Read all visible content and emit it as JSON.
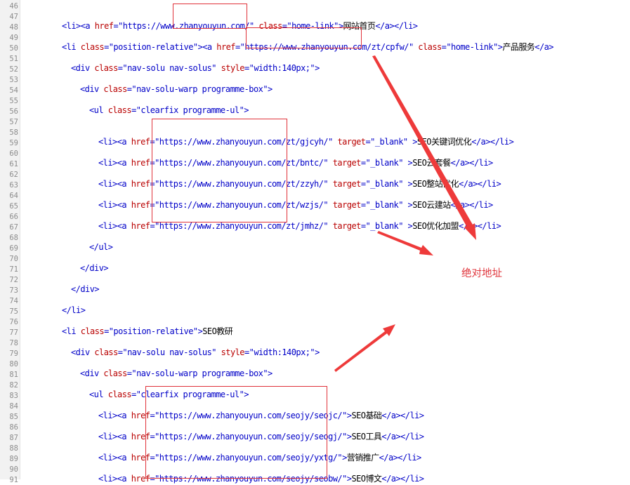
{
  "editor": {
    "line_numbers": [
      "46",
      "47",
      "48",
      "49",
      "50",
      "51",
      "52",
      "53",
      "54",
      "55",
      "56",
      "57",
      "58",
      "59",
      "60",
      "61",
      "62",
      "63",
      "64",
      "65",
      "66",
      "67",
      "68",
      "69",
      "70",
      "71",
      "72",
      "73",
      "74",
      "75",
      "76",
      "77",
      "78",
      "79",
      "80",
      "81",
      "82",
      "83",
      "84",
      "85",
      "86",
      "87",
      "88",
      "89",
      "90",
      "91"
    ],
    "lines": [
      {
        "ln": "47",
        "tokens": [
          [
            "t",
            "<li><a "
          ],
          [
            "a",
            "href"
          ],
          [
            "t",
            "=\"https://www."
          ],
          [
            "t",
            "zhanyouyun.com/"
          ],
          [
            "t",
            "\" "
          ],
          [
            "a",
            "class"
          ],
          [
            "t",
            "=\"home-link\">"
          ],
          [
            "x",
            "网站首页"
          ],
          [
            "t",
            "</a></li>"
          ]
        ]
      },
      {
        "ln": "49",
        "tokens": [
          [
            "t",
            "<li "
          ],
          [
            "a",
            "class"
          ],
          [
            "t",
            "=\"position-relative\"><a "
          ],
          [
            "a",
            "href"
          ],
          [
            "t",
            "=\"https://www.zhanyouyun.com/zt/cpfw/\" "
          ],
          [
            "a",
            "class"
          ],
          [
            "t",
            "=\"home-link\">"
          ],
          [
            "x",
            "产品服务"
          ],
          [
            "t",
            "</a>"
          ]
        ]
      },
      {
        "ln": "51",
        "tokens": [
          [
            "t",
            "<div "
          ],
          [
            "a",
            "class"
          ],
          [
            "t",
            "=\"nav-solu nav-solus\" "
          ],
          [
            "a",
            "style"
          ],
          [
            "t",
            "=\"width:140px;\">"
          ]
        ]
      },
      {
        "ln": "53",
        "tokens": [
          [
            "t",
            "<div "
          ],
          [
            "a",
            "class"
          ],
          [
            "t",
            "=\"nav-solu-warp programme-box\">"
          ]
        ]
      },
      {
        "ln": "55",
        "tokens": [
          [
            "t",
            "<ul "
          ],
          [
            "a",
            "class"
          ],
          [
            "t",
            "=\"clearfix programme-ul\">"
          ]
        ]
      },
      {
        "ln": "58",
        "tokens": [
          [
            "t",
            "<li><a "
          ],
          [
            "a",
            "href"
          ],
          [
            "t",
            "=\"https://www.zhanyouyun.com/zt/gjcyh/\" "
          ],
          [
            "a",
            "target"
          ],
          [
            "t",
            "=\"_blank\" >"
          ],
          [
            "x",
            "SEO关键词优化"
          ],
          [
            "t",
            "</a></li>"
          ]
        ]
      },
      {
        "ln": "60",
        "tokens": [
          [
            "t",
            "<li><a "
          ],
          [
            "a",
            "href"
          ],
          [
            "t",
            "=\"https://www.zhanyouyun.com/zt/bntc/\" "
          ],
          [
            "a",
            "target"
          ],
          [
            "t",
            "=\"_blank\" >"
          ],
          [
            "x",
            "SEO云套餐"
          ],
          [
            "t",
            "</a></li>"
          ]
        ]
      },
      {
        "ln": "62",
        "tokens": [
          [
            "t",
            "<li><a "
          ],
          [
            "a",
            "href"
          ],
          [
            "t",
            "=\"https://www.zhanyouyun.com/zt/zzyh/\" "
          ],
          [
            "a",
            "target"
          ],
          [
            "t",
            "=\"_blank\" >"
          ],
          [
            "x",
            "SEO整站优化"
          ],
          [
            "t",
            "</a></li>"
          ]
        ]
      },
      {
        "ln": "64",
        "tokens": [
          [
            "t",
            "<li><a "
          ],
          [
            "a",
            "href"
          ],
          [
            "t",
            "=\"https://www.zhanyouyun.com/zt/wzjs/\" "
          ],
          [
            "a",
            "target"
          ],
          [
            "t",
            "=\"_blank\" >"
          ],
          [
            "x",
            "SEO云建站"
          ],
          [
            "t",
            "</a></li>"
          ]
        ]
      },
      {
        "ln": "66",
        "tokens": [
          [
            "t",
            "<li><a "
          ],
          [
            "a",
            "href"
          ],
          [
            "t",
            "=\"https://www.zhanyouyun.com/zt/jmhz/\" "
          ],
          [
            "a",
            "target"
          ],
          [
            "t",
            "=\"_blank\" >"
          ],
          [
            "x",
            "SEO优化加盟"
          ],
          [
            "t",
            "</a></li>"
          ]
        ]
      },
      {
        "ln": "68",
        "tokens": [
          [
            "t",
            "</ul>"
          ]
        ]
      },
      {
        "ln": "70",
        "tokens": [
          [
            "t",
            "</div>"
          ]
        ]
      },
      {
        "ln": "72",
        "tokens": [
          [
            "t",
            "</div>"
          ]
        ]
      },
      {
        "ln": "74",
        "tokens": [
          [
            "t",
            "</li>"
          ]
        ]
      },
      {
        "ln": "76",
        "tokens": [
          [
            "t",
            "<li "
          ],
          [
            "a",
            "class"
          ],
          [
            "t",
            "=\"position-relative\">"
          ],
          [
            "x",
            "SEO教研"
          ]
        ]
      },
      {
        "ln": "78",
        "tokens": [
          [
            "t",
            "<div "
          ],
          [
            "a",
            "class"
          ],
          [
            "t",
            "=\"nav-solu nav-solus\" "
          ],
          [
            "a",
            "style"
          ],
          [
            "t",
            "=\"width:140px;\">"
          ]
        ]
      },
      {
        "ln": "80",
        "tokens": [
          [
            "t",
            "<div "
          ],
          [
            "a",
            "class"
          ],
          [
            "t",
            "=\"nav-solu-warp programme-box\">"
          ]
        ]
      },
      {
        "ln": "82",
        "tokens": [
          [
            "t",
            "<ul "
          ],
          [
            "a",
            "class"
          ],
          [
            "t",
            "=\"clearfix programme-ul\">"
          ]
        ]
      },
      {
        "ln": "84",
        "tokens": [
          [
            "t",
            "<li><a "
          ],
          [
            "a",
            "href"
          ],
          [
            "t",
            "=\"https://www.zhanyouyun.com/seojy/seojc/\">"
          ],
          [
            "x",
            "SEO基础"
          ],
          [
            "t",
            "</a></li>"
          ]
        ]
      },
      {
        "ln": "86",
        "tokens": [
          [
            "t",
            "<li><a "
          ],
          [
            "a",
            "href"
          ],
          [
            "t",
            "=\"https://www.zhanyouyun.com/seojy/seogj/\">"
          ],
          [
            "x",
            "SEO工具"
          ],
          [
            "t",
            "</a></li>"
          ]
        ]
      },
      {
        "ln": "88",
        "tokens": [
          [
            "t",
            "<li><a "
          ],
          [
            "a",
            "href"
          ],
          [
            "t",
            "=\"https://www.zhanyouyun.com/seojy/yxtg/\">"
          ],
          [
            "x",
            "营销推广"
          ],
          [
            "t",
            "</a></li>"
          ]
        ]
      },
      {
        "ln": "90",
        "tokens": [
          [
            "t",
            "<li><a "
          ],
          [
            "a",
            "href"
          ],
          [
            "t",
            "=\"https://www.zhanyouyun.com/seojy/seobw/\">"
          ],
          [
            "x",
            "SEO博文"
          ],
          [
            "t",
            "</a></li>"
          ]
        ]
      }
    ]
  },
  "annotation": {
    "label": "绝对地址",
    "color": "#e0363d",
    "arrow_icon": "red-arrow-icon",
    "box_icon": "red-highlight-box"
  }
}
